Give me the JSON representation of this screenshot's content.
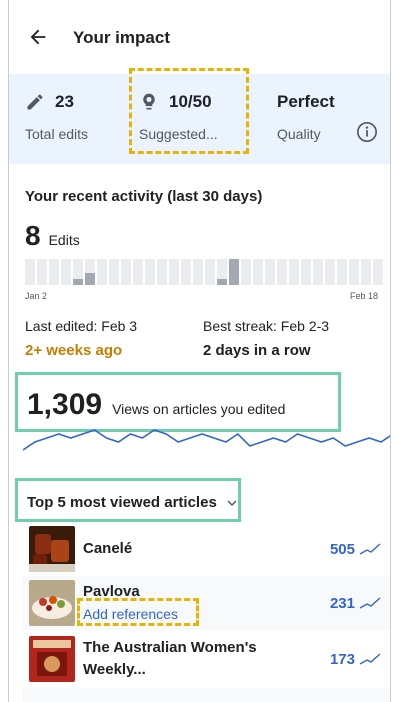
{
  "header": {
    "title": "Your impact"
  },
  "stats": {
    "edits": {
      "value": "23",
      "label": "Total edits"
    },
    "suggested": {
      "value": "10/50",
      "label": "Suggested..."
    },
    "quality": {
      "value": "Perfect",
      "label": "Quality"
    }
  },
  "activity": {
    "title": "Your recent activity (last 30 days)",
    "edits_count": "8",
    "edits_unit": "Edits",
    "start_label": "Jan 2",
    "end_label": "Feb 18",
    "daily_levels": [
      0,
      0,
      0,
      0,
      0.25,
      0.45,
      0,
      0,
      0,
      0,
      0,
      0,
      0,
      0,
      0,
      0,
      0.25,
      1,
      0,
      0,
      0,
      0,
      0,
      0,
      0,
      0,
      0,
      0,
      0,
      0
    ],
    "last_edited_label": "Last edited: Feb 3",
    "last_edited_value": "2+ weeks ago",
    "best_streak_label": "Best streak: Feb 2-3",
    "best_streak_value": "2 days in a row"
  },
  "views": {
    "total": "1,309",
    "label": "Views on articles you edited",
    "trend": [
      4,
      6,
      7,
      8,
      7,
      8,
      9,
      7,
      6,
      8,
      7,
      9,
      8,
      6,
      7,
      8,
      7,
      6,
      8,
      5,
      6,
      7,
      6,
      8,
      7,
      6,
      7,
      5,
      6,
      7,
      6,
      8
    ]
  },
  "top_articles": {
    "heading": "Top 5 most viewed articles",
    "items": [
      {
        "title": "Canelé",
        "views": "505"
      },
      {
        "title": "Pavlova",
        "link": "Add references",
        "views": "231"
      },
      {
        "title_line1": "The Australian Women's",
        "title_line2": "Weekly...",
        "views": "173"
      }
    ]
  },
  "colors": {
    "accent": "#3366cc",
    "highlight_orange": "#e8b400",
    "highlight_green": "#6fcfad",
    "warn": "#c57f00",
    "stats_bg": "#eaf3ff"
  }
}
